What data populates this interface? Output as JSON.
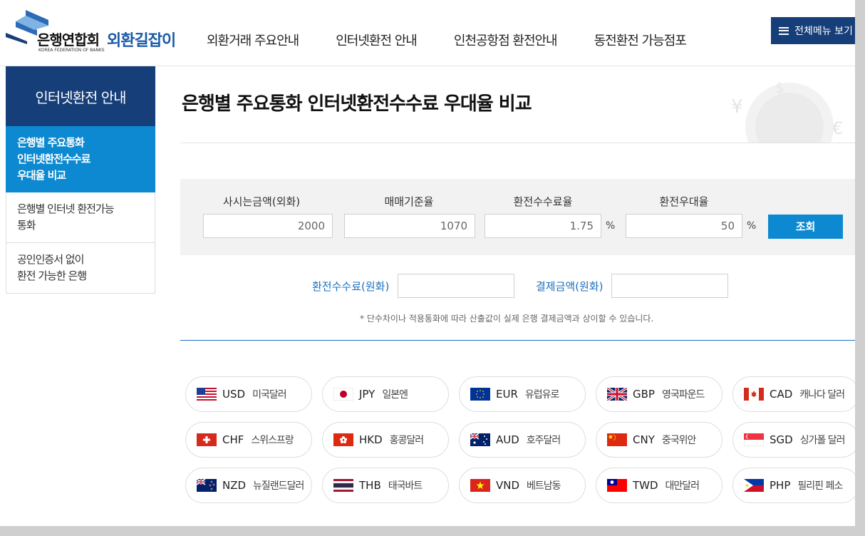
{
  "header": {
    "logo_bank": "은행연합회",
    "logo_eng": "KOREA FEDERATION OF BANKS",
    "logo_service": "외환길잡이",
    "nav": [
      "외환거래 주요안내",
      "인터넷환전 안내",
      "인천공항점 환전안내",
      "동전환전 가능점포"
    ],
    "menu_button": "전체메뉴 보기"
  },
  "sidebar": {
    "title": "인터넷환전 안내",
    "items": [
      {
        "label": "은행별 주요통화\n인터넷환전수수료\n우대율 비교",
        "active": true
      },
      {
        "label": "은행별 인터넷 환전가능\n통화",
        "active": false
      },
      {
        "label": "공인인증서 없이\n환전 가능한 은행",
        "active": false
      }
    ]
  },
  "main": {
    "title": "은행별 주요통화 인터넷환전수수료 우대율 비교",
    "calc": {
      "amount_label": "사시는금액(외화)",
      "amount_value": "2000",
      "rate_label": "매매기준율",
      "rate_value": "1070",
      "fee_label": "환전수수료율",
      "fee_value": "1.75",
      "pref_label": "환전우대율",
      "pref_value": "50",
      "percent": "%",
      "search_button": "조회"
    },
    "result": {
      "fee_label": "환전수수료(원화)",
      "pay_label": "결제금액(원화)"
    },
    "note": "* 단수차이나 적용통화에 따라 산출값이 실제 은행 결제금액과 상이할 수 있습니다.",
    "currencies": [
      {
        "code": "USD",
        "name": "미국달러"
      },
      {
        "code": "JPY",
        "name": "일본엔"
      },
      {
        "code": "EUR",
        "name": "유럽유로"
      },
      {
        "code": "GBP",
        "name": "영국파운드"
      },
      {
        "code": "CAD",
        "name": "캐나다 달러"
      },
      {
        "code": "CHF",
        "name": "스위스프랑"
      },
      {
        "code": "HKD",
        "name": "홍콩달러"
      },
      {
        "code": "AUD",
        "name": "호주달러"
      },
      {
        "code": "CNY",
        "name": "중국위안"
      },
      {
        "code": "SGD",
        "name": "싱가폴 달러"
      },
      {
        "code": "NZD",
        "name": "뉴질랜드달러"
      },
      {
        "code": "THB",
        "name": "태국바트"
      },
      {
        "code": "VND",
        "name": "베트남동"
      },
      {
        "code": "TWD",
        "name": "대만달러"
      },
      {
        "code": "PHP",
        "name": "필리핀 페소"
      }
    ]
  },
  "colors": {
    "navy": "#163e78",
    "accent_blue": "#0c89d0",
    "link_blue": "#1a6fbe"
  }
}
